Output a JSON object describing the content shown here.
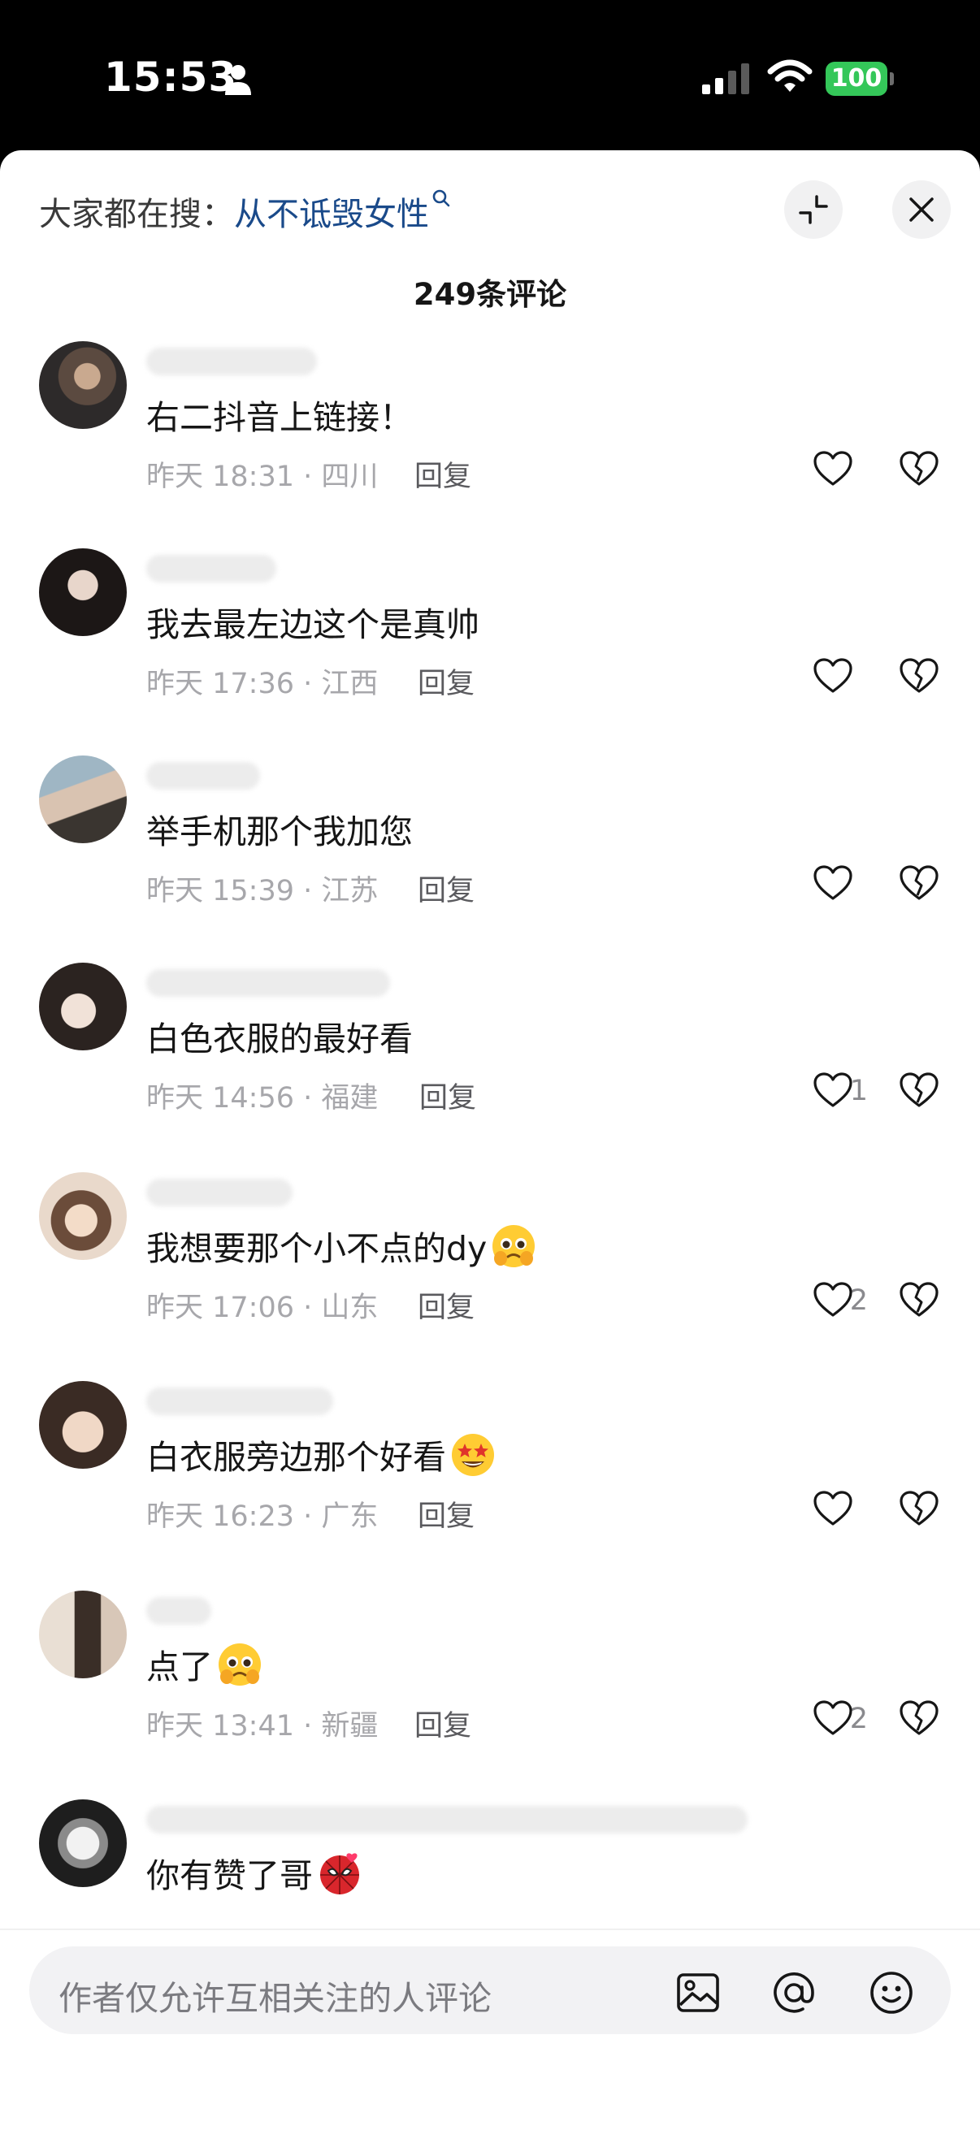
{
  "status_bar": {
    "time": "15:53",
    "battery": "100",
    "battery_color": "#34c759"
  },
  "header": {
    "hint_label": "大家都在搜：",
    "hint_term": "从不诋毁女性",
    "hint_color": "#1a4a8a",
    "comment_count": "249条评论"
  },
  "comments": [
    {
      "text": "右二抖音上链接！",
      "emoji": "",
      "meta": "昨天 18:31 · 四川",
      "reply": "回复",
      "likes": ""
    },
    {
      "text": "我去最左边这个是真帅",
      "emoji": "",
      "meta": "昨天 17:36 · 江西",
      "reply": "回复",
      "likes": ""
    },
    {
      "text": "举手机那个我加您",
      "emoji": "",
      "meta": "昨天 15:39 · 江苏",
      "reply": "回复",
      "likes": ""
    },
    {
      "text": "白色衣服的最好看",
      "emoji": "",
      "meta": "昨天 14:56 · 福建",
      "reply": "回复",
      "likes": "1"
    },
    {
      "text": "我想要那个小不点的dy",
      "emoji": "pleading-face",
      "meta": "昨天 17:06 · 山东",
      "reply": "回复",
      "likes": "2"
    },
    {
      "text": "白衣服旁边那个好看",
      "emoji": "star-struck-face",
      "meta": "昨天 16:23 · 广东",
      "reply": "回复",
      "likes": ""
    },
    {
      "text": "点了",
      "emoji": "pleading-face",
      "meta": "昨天 13:41 · 新疆",
      "reply": "回复",
      "likes": "2"
    },
    {
      "text": "你有赞了哥",
      "emoji": "spider-hero-face",
      "meta": "",
      "reply": "",
      "likes": ""
    }
  ],
  "input": {
    "placeholder": "作者仅允许互相关注的人评论"
  },
  "icons": [
    "person-icon",
    "signal-icon",
    "wifi-icon",
    "search-icon",
    "shrink-icon",
    "close-icon",
    "heart-icon",
    "broken-heart-icon",
    "image-icon",
    "at-icon",
    "emoji-icon"
  ]
}
